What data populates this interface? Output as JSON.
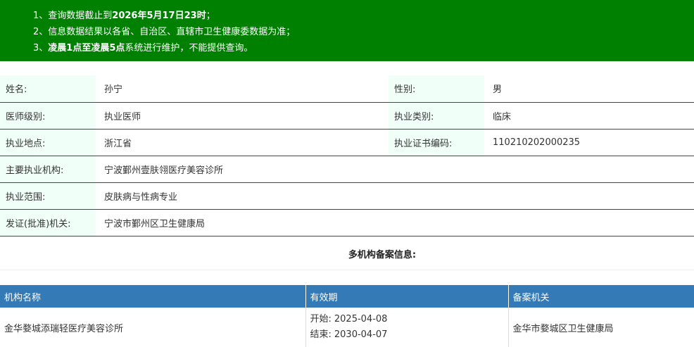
{
  "notice": {
    "line1_prefix": "1、查询数据截止到",
    "line1_bold": "2026年5月17日23时",
    "line1_suffix": "；",
    "line2": "2、信息数据结果以各省、自治区、直辖市卫生健康委数据为准；",
    "line3_prefix": "3、",
    "line3_bold": "凌晨1点至凌晨5点",
    "line3_suffix": "系统进行维护，不能提供查询。"
  },
  "info": {
    "name_label": "姓名:",
    "name_value": "孙宁",
    "gender_label": "性别:",
    "gender_value": "男",
    "level_label": "医师级别:",
    "level_value": "执业医师",
    "category_label": "执业类别:",
    "category_value": "临床",
    "location_label": "执业地点:",
    "location_value": "浙江省",
    "cert_label": "执业证书编码:",
    "cert_value": "110210202000235",
    "org_label": "主要执业机构:",
    "org_value": "宁波鄞州壹肤翎医疗美容诊所",
    "scope_label": "执业范围:",
    "scope_value": "皮肤病与性病专业",
    "issuer_label": "发证(批准)机关:",
    "issuer_value": "宁波市鄞州区卫生健康局"
  },
  "multi": {
    "title": "多机构备案信息:",
    "headers": {
      "org": "机构名称",
      "period": "有效期",
      "authority": "备案机关"
    },
    "rows": [
      {
        "org": "金华婺城添瑞轻医疗美容诊所",
        "start_label": "开始:",
        "start": "2025-04-08",
        "end_label": "结束:",
        "end": "2030-04-07",
        "authority": "金华市婺城区卫生健康局"
      }
    ]
  },
  "colors": {
    "notice_bg": "#008000",
    "label_bg": "#f0fff8",
    "header_bg": "#337ab7",
    "row_border": "#1f5c3a"
  }
}
